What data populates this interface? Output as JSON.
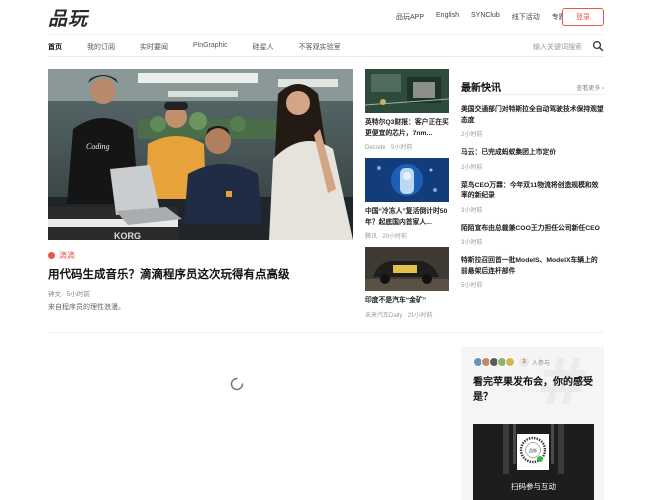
{
  "header": {
    "logo": "品玩",
    "links": [
      "品玩APP",
      "English",
      "SYNClub",
      "线下活动",
      "专题"
    ],
    "login_label": "登录"
  },
  "nav": {
    "items": [
      "首页",
      "我的订阅",
      "实时要闻",
      "PinGraphic",
      "硅星人",
      "不客观实验室"
    ],
    "active_index": 0,
    "search_placeholder": "输入关键词搜索"
  },
  "hero": {
    "tag": "滴滴",
    "title": "用代码生成音乐？滴滴程序员这次玩得有点高级",
    "author": "钟文",
    "time": "5小时前",
    "description": "来自程序员的理性浪漫。",
    "image_caption_shirt": "Coding",
    "image_keyboard_brand": "KORG"
  },
  "middle_articles": [
    {
      "title": "英特尔Q3财报：客户正在买更便宜的芯片，7nm...",
      "source": "Decode",
      "time": "5小时前"
    },
    {
      "title": "中国“冷冻人”复活倒计时50年？起底国内首家人...",
      "source": "腾讯",
      "time": "20小时前"
    },
    {
      "title": "印度不是汽车“金矿”",
      "source": "未来汽车Daily",
      "time": "21小时前"
    }
  ],
  "flash_news": {
    "title": "最新快讯",
    "more_label": "查看更多",
    "items": [
      {
        "text": "美国交通部门对特斯拉全自动驾驶技术保持观望态度",
        "time": "2小时前"
      },
      {
        "text": "马云：已完成蚂蚁集团上市定价",
        "time": "2小时前"
      },
      {
        "text": "菜鸟CEO万霖：今年双11物流将创造规模和效率的新纪录",
        "time": "3小时前"
      },
      {
        "text": "陌陌宣布由总裁兼COO王力担任公司新任CEO",
        "time": "3小时前"
      },
      {
        "text": "特斯拉召回首一批ModelS、ModelX车辆上的前悬架后连杆部件",
        "time": "5小时前"
      }
    ]
  },
  "discussion": {
    "watermark": "#",
    "participant_count": "3",
    "participant_label": "人参与",
    "question": "看完苹果发布会，你的感受是？",
    "qr_brand": "品铄",
    "cta": "扫码参与互动",
    "avatar_colors": [
      "#6b8fb5",
      "#c48a5e",
      "#5a5a5a",
      "#8bb36e",
      "#d9b34c"
    ]
  },
  "colors": {
    "accent": "#e8574a",
    "text_primary": "#111111",
    "text_muted": "#999999"
  },
  "icons": {
    "search": "search-icon",
    "chevron": "chevron-right-icon",
    "spinner": "loading-spinner-icon",
    "tag_dot": "tag-dot-icon"
  }
}
